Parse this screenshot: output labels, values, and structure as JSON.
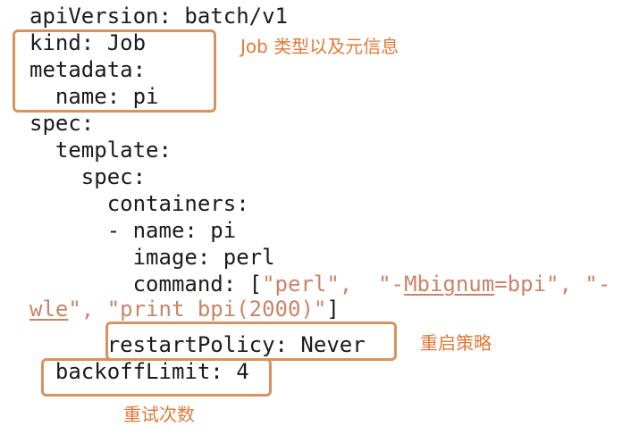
{
  "yaml_lines": [
    "apiVersion: batch/v1",
    "kind: Job",
    "metadata:",
    "  name: pi",
    "spec:",
    "  template:",
    "    spec:",
    "      containers:",
    "      - name: pi",
    "        image: perl",
    "        command: [",
    "\"perl\"",
    ",  ",
    "\"-",
    "Mbignum",
    "=bpi\"",
    ", ",
    "\"-",
    "wle",
    "\", \"print bpi(2000)\"",
    "]",
    "      restartPolicy: Never",
    "  backoffLimit: 4"
  ],
  "annotations": {
    "job_meta": "Job 类型以及元信息",
    "restart_policy": "重启策略",
    "retry_count": "重试次数"
  },
  "colors": {
    "box": "#d8925f",
    "annotation": "#e07a3c",
    "string": "#c9846a",
    "code": "#1b1b1b"
  }
}
